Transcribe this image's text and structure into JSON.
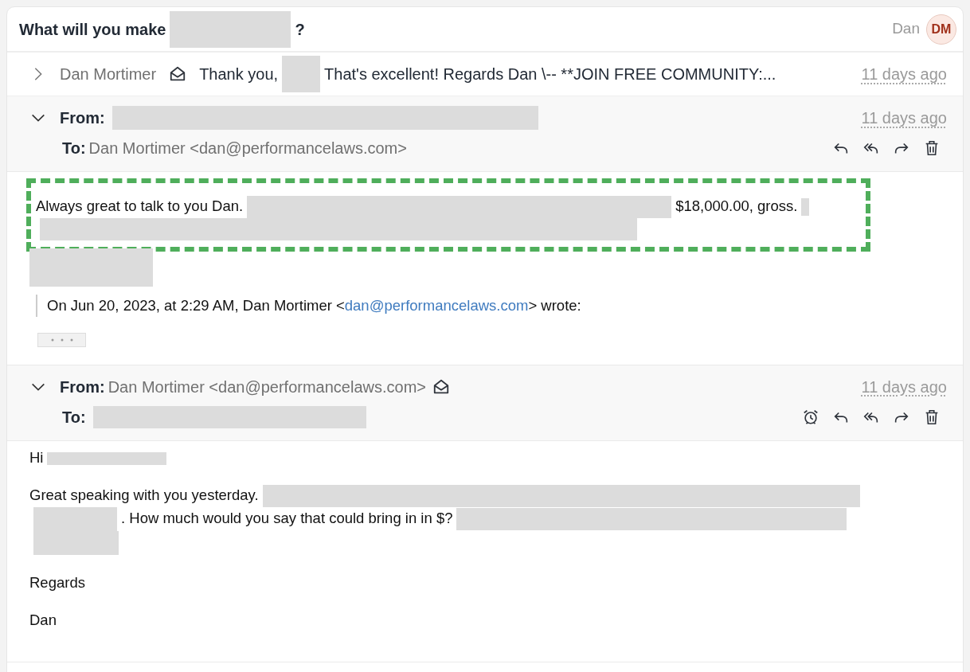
{
  "thread": {
    "subject": [
      {
        "kind": "text",
        "text": "What will you make"
      },
      {
        "kind": "redacted"
      },
      {
        "kind": "text",
        "text": "?"
      }
    ],
    "participant": {
      "name": "Dan",
      "initials": "DM"
    }
  },
  "messages": [
    {
      "expanded": false,
      "sender": "Dan Mortimer",
      "opened": true,
      "snippet": [
        {
          "kind": "text",
          "text": "Thank you,"
        },
        {
          "kind": "redacted"
        },
        {
          "kind": "text",
          "text": "That's excellent! Regards Dan \\-- **JOIN FREE COMMUNITY:..."
        }
      ],
      "date": "11 days ago"
    },
    {
      "expanded": true,
      "from_label": "From:",
      "from": [
        {
          "kind": "redacted"
        }
      ],
      "date": "11 days ago",
      "to_label": "To:",
      "to": [
        {
          "kind": "text",
          "text": "Dan Mortimer <dan@performancelaws.com>"
        }
      ],
      "actions": [
        {
          "kind": "reply"
        },
        {
          "kind": "reply_all"
        },
        {
          "kind": "forward"
        },
        {
          "kind": "delete"
        }
      ],
      "body": [
        {
          "highlighted": true,
          "segments": [
            {
              "kind": "text",
              "text": "Always great to talk to you Dan."
            },
            {
              "kind": "redacted"
            },
            {
              "kind": "text",
              "text": "$18,000.00, gross."
            },
            {
              "kind": "redacted"
            },
            {
              "kind": "break"
            },
            {
              "kind": "redacted"
            }
          ]
        },
        {
          "segments": [
            {
              "kind": "redacted"
            }
          ]
        }
      ],
      "quote": [
        {
          "kind": "text",
          "text": "On Jun 20, 2023, at 2:29 AM, Dan Mortimer <"
        },
        {
          "kind": "link",
          "text": "dan@performancelaws.com"
        },
        {
          "kind": "text",
          "text": "> wrote:"
        }
      ],
      "quote_collapsed": true
    },
    {
      "expanded": true,
      "from_label": "From:",
      "from": [
        {
          "kind": "text",
          "text": "Dan Mortimer <dan@performancelaws.com>"
        }
      ],
      "opened": true,
      "date": "11 days ago",
      "to_label": "To:",
      "to": [
        {
          "kind": "redacted"
        }
      ],
      "actions": [
        {
          "kind": "snooze"
        },
        {
          "kind": "reply"
        },
        {
          "kind": "reply_all"
        },
        {
          "kind": "forward"
        },
        {
          "kind": "delete"
        }
      ],
      "body": [
        {
          "segments": [
            {
              "kind": "text",
              "text": "Hi"
            },
            {
              "kind": "redacted"
            }
          ]
        },
        {
          "segments": [
            {
              "kind": "text",
              "text": "Great speaking with you yesterday."
            },
            {
              "kind": "redacted"
            },
            {
              "kind": "break"
            },
            {
              "kind": "redacted"
            },
            {
              "kind": "text",
              "text": ". How much would you say that could bring in in $?"
            },
            {
              "kind": "redacted"
            },
            {
              "kind": "break"
            },
            {
              "kind": "redacted"
            }
          ]
        },
        {
          "segments": [
            {
              "kind": "text",
              "text": "Regards"
            }
          ]
        },
        {
          "segments": [
            {
              "kind": "text",
              "text": "Dan"
            }
          ]
        }
      ]
    }
  ]
}
